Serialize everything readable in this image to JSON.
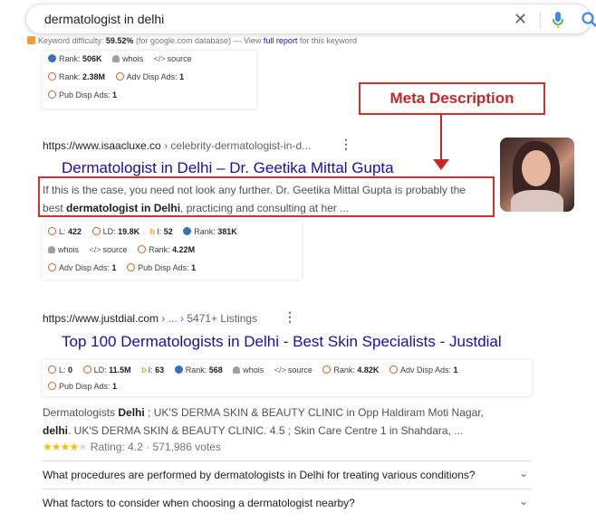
{
  "search": {
    "query": "dermatologist in delhi",
    "clear_icon": "✕"
  },
  "keyword_line": {
    "label": "Keyword difficulty:",
    "value": "59.52%",
    "suffix": "(for google.com database) — View",
    "link1": "full",
    "link2": "report",
    "tail": "for this keyword"
  },
  "panel_top": {
    "rank_label": "Rank:",
    "rank_value": "506K",
    "whois": "whois",
    "source": "source",
    "rank2_label": "Rank:",
    "rank2_value": "2.38M",
    "adv_label": "Adv Disp Ads:",
    "adv_value": "1",
    "pub_label": "Pub Disp Ads:",
    "pub_value": "1"
  },
  "result1": {
    "url": "https://www.isaacluxe.co",
    "path": " › celebrity-dermatologist-in-d...",
    "title": "Dermatologist in Delhi – Dr. Geetika Mittal Gupta",
    "snippet_line1": "If this is the case, you need not look any further. Dr. Geetika Mittal Gupta is probably the",
    "snippet_pre": "best ",
    "snippet_bold": "dermatologist in Delhi",
    "snippet_post": ", practicing and consulting at her ...",
    "metrics": {
      "l_label": "L:",
      "l_value": "422",
      "ld_label": "LD:",
      "ld_value": "19.8K",
      "i_label": "I:",
      "i_value": "52",
      "rank_label": "Rank:",
      "rank_value": "381K",
      "whois": "whois",
      "source": "source",
      "rank2_label": "Rank:",
      "rank2_value": "4.22M",
      "adv_label": "Adv Disp Ads:",
      "adv_value": "1",
      "pub_label": "Pub Disp Ads:",
      "pub_value": "1"
    }
  },
  "annotation": {
    "label": "Meta Description",
    "color": "#d32f2f"
  },
  "result2": {
    "url": "https://www.justdial.com",
    "path": " › ... › 5471+ Listings",
    "title": "Top 100 Dermatologists in Delhi - Best Skin Specialists - Justdial",
    "metrics": {
      "l_label": "L:",
      "l_value": "0",
      "ld_label": "LD:",
      "ld_value": "11.5M",
      "i_label": "I:",
      "i_value": "63",
      "rank_label": "Rank:",
      "rank_value": "568",
      "whois": "whois",
      "source": "source",
      "rank2_label": "Rank:",
      "rank2_value": "4.82K",
      "adv_label": "Adv Disp Ads:",
      "adv_value": "1",
      "pub_label": "Pub Disp Ads:",
      "pub_value": "1"
    },
    "snippet_a1": "Dermatologists ",
    "snippet_b1": "Delhi",
    "snippet_a2": " ; UK'S DERMA SKIN & BEAUTY CLINIC in Opp Haldiram Moti Nagar,",
    "snippet_b2": "delhi",
    "snippet_a3": ". UK'S DERMA SKIN & BEAUTY CLINIC. 4.5 ; Skin Care Centre 1 in Shahdara, ...",
    "rating_value": 4.2,
    "rating_text": "Rating: 4.2 · 571,986 votes"
  },
  "faq": [
    {
      "question": "What procedures are performed by dermatologists in Delhi for treating various conditions?"
    },
    {
      "question": "What factors to consider when choosing a dermatologist nearby?"
    }
  ],
  "colors": {
    "link": "#1a0dab",
    "annotation_red": "#d32f2f",
    "star": "#fbbc04"
  },
  "icons": [
    "search-icon",
    "mic-icon",
    "close-icon",
    "more-vert-icon",
    "chevron-down-icon",
    "moz-circle-icon",
    "alexa-icon",
    "bing-icon",
    "user-icon",
    "code-icon",
    "keyword-icon"
  ]
}
